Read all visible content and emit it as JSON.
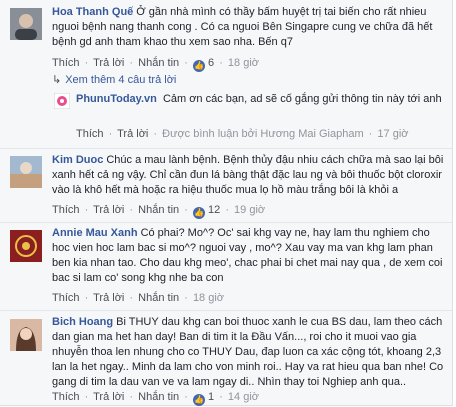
{
  "comments": [
    {
      "name": "Hoa Thanh Quế",
      "text": "Ở gần nhà mình có thầy bấm huyệt trị tai biến cho rất nhieu nguoi bệnh nang thanh cong . Có ca nguoi Bên Singapre cung ve chữa đã hết bệnh gd anh tham khao thu xem sao nha. Bến q7",
      "actions": {
        "like": "Thích",
        "reply": "Trả lời",
        "message": "Nhắn tin",
        "likes": "6",
        "time": "18 giờ"
      }
    },
    {
      "name": "Kim Duoc",
      "text": "Chúc a mau lành bệnh. Bệnh thủy đậu nhiu cách chữa mà sao lại bôi xanh hết cả ng vậy. Chỉ cần đun lá bàng thật đặc lau ng và bôi thuốc bột cloroxir vào là khô hết mà hoặc ra hiệu thuốc mua lọ hồ màu trắng bôi là khỏi a",
      "actions": {
        "like": "Thích",
        "reply": "Trả lời",
        "message": "Nhắn tin",
        "likes": "12",
        "time": "19 giờ"
      }
    },
    {
      "name": "Annie Mau Xanh",
      "text": "Có phai? Mo^? Oc' sai khg vay ne, hay lam thu nghiem cho hoc vien hoc lam bac si mo^? nguoi vay , mo^? Xau vay ma van khg lam phan ben kia nhan tao. Cho dau khg meo', chac phai bi chet mai nay qua , de xem coi bac si lam co' song khg nhe ba con",
      "actions": {
        "like": "Thích",
        "reply": "Trả lời",
        "message": "Nhắn tin",
        "likes": "",
        "time": "18 giờ"
      }
    },
    {
      "name": "Bich Hoang",
      "text": "Bi THUY dau khg can boi thuoc xanh le cua BS dau, lam theo cách dan gian ma het han day! Ban di tim it la Đầu Vấn..., roi cho it muoi vao gia nhuyễn thoa len nhung cho co THUY Dau, đap luon ca xác cộng tót, khoang 2,3 lan la het ngay.. Minh da lam cho von minh roi.. Hay va rat hieu qua ban nhe! Co gang di tim la dau van ve va lam ngay di.. Nhìn thay toi Nghiep anh qua..",
      "actions": {
        "like": "Thích",
        "reply": "Trả lời",
        "message": "Nhắn tin",
        "likes": "1",
        "time": "14 giờ"
      }
    }
  ],
  "replies_toggle": {
    "text": "Xem thêm 4 câu trả lời"
  },
  "page_reply": {
    "name": "PhunuToday.vn",
    "text": "Cảm ơn các bạn, ad sẽ cố gắng gửi thông tin này tới anh",
    "actions": {
      "like": "Thích",
      "reply": "Trả lời",
      "edited_by": "Được bình luận bởi Hương Mai Giapham",
      "time": "17 giờ"
    }
  },
  "icons": {
    "like": "thumbs-up-icon",
    "reply_arrow": "reply-arrow-icon"
  },
  "colors": {
    "link": "#365899",
    "like_badge": "#4267b2",
    "panel_bg": "#f6f7f9"
  }
}
